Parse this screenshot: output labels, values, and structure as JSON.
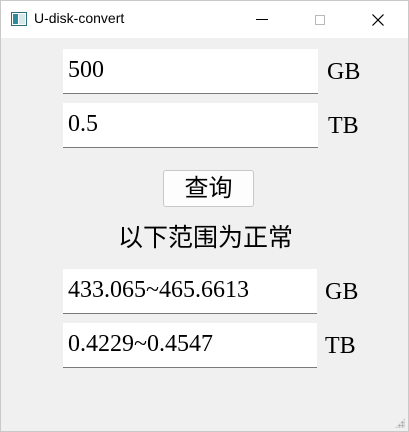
{
  "window": {
    "title": "U-disk-convert",
    "icons": {
      "app": "app-window-icon",
      "minimize": "minimize-icon",
      "maximize": "maximize-icon",
      "close": "close-icon"
    }
  },
  "inputs": {
    "gb_value": "500",
    "gb_unit": "GB",
    "tb_value": "0.5",
    "tb_unit": "TB"
  },
  "query_button": {
    "label": "查询"
  },
  "range_label": "以下范围为正常",
  "results": {
    "gb_range": "433.065~465.6613",
    "gb_unit": "GB",
    "tb_range": "0.4229~0.4547",
    "tb_unit": "TB"
  }
}
